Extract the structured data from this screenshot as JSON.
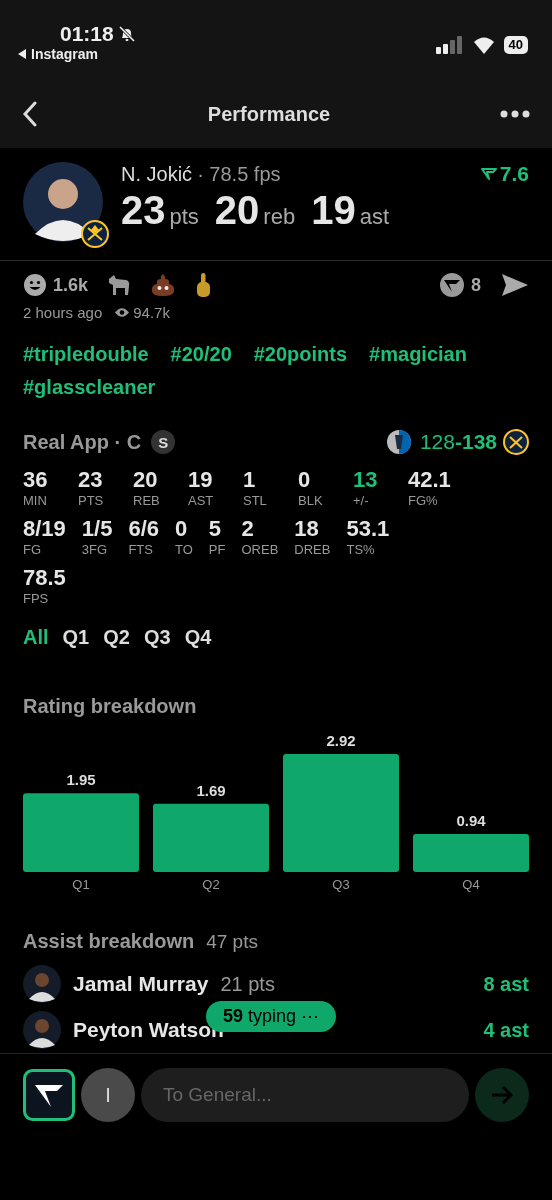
{
  "status_bar": {
    "time": "01:18",
    "back_app": "Instagram",
    "battery": "40"
  },
  "nav": {
    "title": "Performance"
  },
  "player": {
    "name": "N. Jokić",
    "fps": "· 78.5 fps",
    "rating": "7.6",
    "stats": [
      {
        "value": "23",
        "unit": "pts"
      },
      {
        "value": "20",
        "unit": "reb"
      },
      {
        "value": "19",
        "unit": "ast"
      }
    ]
  },
  "reactions": {
    "count": "1.6k",
    "comments": "8",
    "time": "2 hours ago",
    "views": "94.7k"
  },
  "hashtags": [
    "#tripledouble",
    "#20/20",
    "#20points",
    "#magician",
    "#glasscleaner"
  ],
  "game": {
    "source": "Real App · C",
    "badge": "S",
    "score_away": "128",
    "score_home": "-138"
  },
  "stat_rows": [
    [
      {
        "value": "36",
        "label": "MIN",
        "highlight": false
      },
      {
        "value": "23",
        "label": "PTS",
        "highlight": false
      },
      {
        "value": "20",
        "label": "REB",
        "highlight": false
      },
      {
        "value": "19",
        "label": "AST",
        "highlight": false
      },
      {
        "value": "1",
        "label": "STL",
        "highlight": false
      },
      {
        "value": "0",
        "label": "BLK",
        "highlight": false
      },
      {
        "value": "13",
        "label": "+/-",
        "highlight": true
      },
      {
        "value": "42.1",
        "label": "FG%",
        "highlight": false
      }
    ],
    [
      {
        "value": "8/19",
        "label": "FG",
        "highlight": false
      },
      {
        "value": "1/5",
        "label": "3FG",
        "highlight": false
      },
      {
        "value": "6/6",
        "label": "FTS",
        "highlight": false
      },
      {
        "value": "0",
        "label": "TO",
        "highlight": false
      },
      {
        "value": "5",
        "label": "PF",
        "highlight": false
      },
      {
        "value": "2",
        "label": "OREB",
        "highlight": false
      },
      {
        "value": "18",
        "label": "DREB",
        "highlight": false
      },
      {
        "value": "53.1",
        "label": "TS%",
        "highlight": false
      }
    ],
    [
      {
        "value": "78.5",
        "label": "FPS",
        "highlight": false
      }
    ]
  ],
  "quarter_tabs": [
    {
      "label": "All",
      "selected": true
    },
    {
      "label": "Q1",
      "selected": false
    },
    {
      "label": "Q2",
      "selected": false
    },
    {
      "label": "Q3",
      "selected": false
    },
    {
      "label": "Q4",
      "selected": false
    }
  ],
  "rating_breakdown": {
    "title": "Rating breakdown",
    "chart_data": {
      "type": "bar",
      "categories": [
        "Q1",
        "Q2",
        "Q3",
        "Q4"
      ],
      "series": [
        {
          "color": "#0fa86a",
          "values": [
            1.95,
            1.69,
            2.92,
            0.94
          ]
        }
      ],
      "data_labels": true
    }
  },
  "assist_breakdown": {
    "title": "Assist breakdown",
    "total": "47 pts",
    "rows": [
      {
        "name": "Jamal Murray",
        "pts": "21 pts",
        "ast": "8 ast"
      },
      {
        "name": "Peyton Watson",
        "ast": "4 ast"
      }
    ]
  },
  "typing": {
    "count": "59",
    "label": "typing ···"
  },
  "composer": {
    "avatar": "I",
    "placeholder": "To General..."
  }
}
